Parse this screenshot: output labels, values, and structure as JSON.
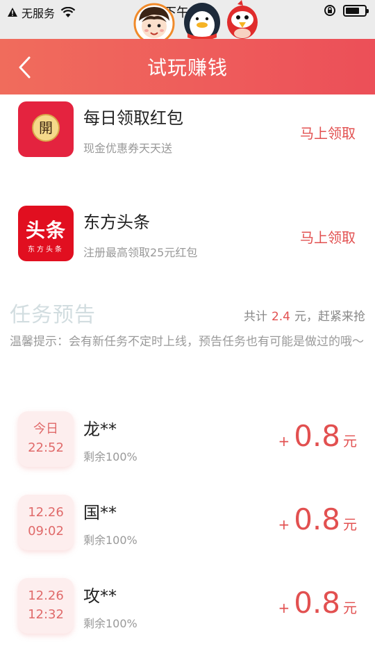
{
  "status_bar": {
    "carrier": "无服务",
    "time": "下午1",
    "battery_level": 0.72
  },
  "nav": {
    "title": "试玩赚钱",
    "back_icon": "chevron-left-icon"
  },
  "featured": [
    {
      "name": "每日领取红包",
      "desc": "现金优惠券天天送",
      "action": "马上领取",
      "icon_text": "開"
    },
    {
      "name": "东方头条",
      "desc": "注册最高领取25元红包",
      "action": "马上领取",
      "icon_text": "头条",
      "icon_subtext": "东方头条"
    }
  ],
  "notice": {
    "title": "任务预告",
    "total_prefix": "共计",
    "total_amount": "2.4",
    "total_suffix": "元，赶紧来抢",
    "tip": "温馨提示：会有新任务不定时上线，预告任务也有可能是做过的哦～"
  },
  "tasks": [
    {
      "date_l1": "今日",
      "date_l2": "22:52",
      "name": "龙**",
      "remain": "剩余100%",
      "plus": "+",
      "value": "0.8",
      "unit": "元"
    },
    {
      "date_l1": "12.26",
      "date_l2": "09:02",
      "name": "国**",
      "remain": "剩余100%",
      "plus": "+",
      "value": "0.8",
      "unit": "元"
    },
    {
      "date_l1": "12.26",
      "date_l2": "12:32",
      "name": "攻**",
      "remain": "剩余100%",
      "plus": "+",
      "value": "0.8",
      "unit": "元"
    }
  ],
  "colors": {
    "accent": "#e25050",
    "nav_gradient_start": "#f06c5c",
    "nav_gradient_end": "#ec4f58"
  }
}
